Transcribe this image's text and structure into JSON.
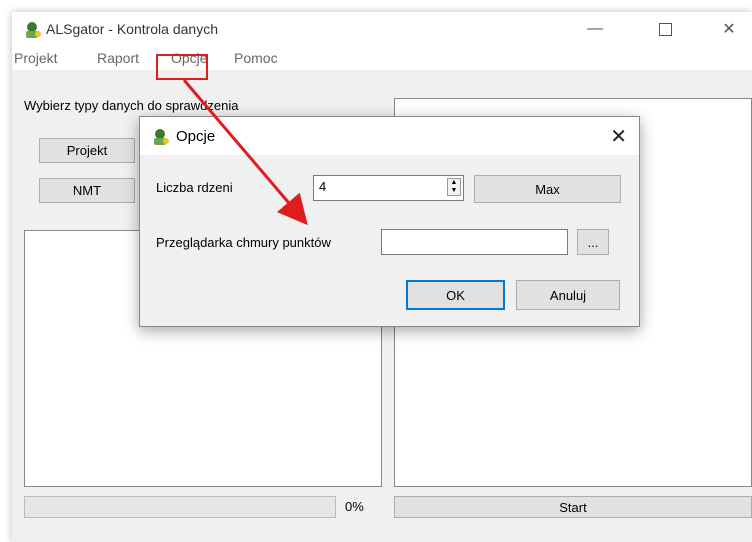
{
  "window": {
    "title": "ALSgator - Kontrola danych"
  },
  "menu": {
    "items": [
      "Projekt",
      "Raport",
      "Opcje",
      "Pomoc"
    ]
  },
  "main": {
    "group_label": "Wybierz typy danych do sprawdzenia",
    "button_projekt": "Projekt",
    "button_nmt": "NMT",
    "progress_percent": "0%",
    "progress_value": 0,
    "start_label": "Start"
  },
  "dialog": {
    "title": "Opcje",
    "cores_label": "Liczba rdzeni",
    "cores_value": "4",
    "max_label": "Max",
    "viewer_label": "Przeglądarka chmury punktów",
    "viewer_value": "",
    "browse_label": "...",
    "ok_label": "OK",
    "cancel_label": "Anuluj"
  },
  "colors": {
    "highlight": "#e01d1d",
    "accent": "#0078d7"
  }
}
